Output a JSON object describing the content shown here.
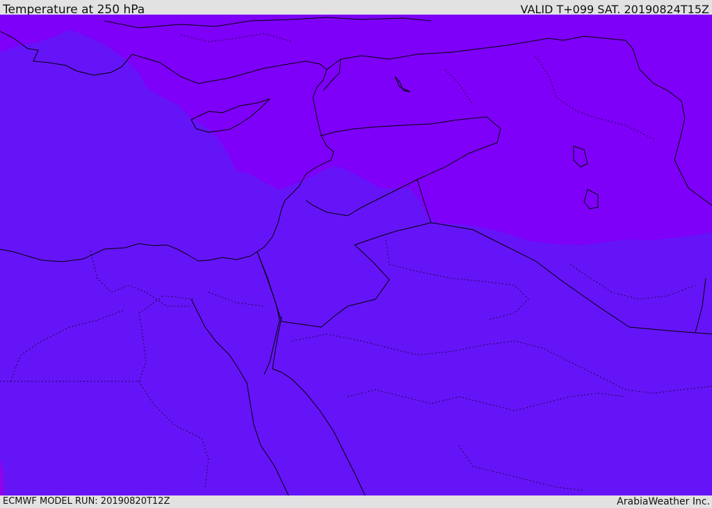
{
  "header": {
    "title": "Temperature at 250 hPa",
    "valid_time": "VALID T+099 SAT. 20190824T15Z"
  },
  "footer": {
    "model_run": "ECMWF MODEL RUN: 20190820T12Z",
    "credit": "ArabiaWeather Inc."
  },
  "map": {
    "field": "Temperature at 250 hPa",
    "colors": {
      "cold_band": "#7e00f8",
      "main_band": "#6514f8",
      "edge_band": "#8a05e8",
      "coastline": "#000000"
    }
  }
}
